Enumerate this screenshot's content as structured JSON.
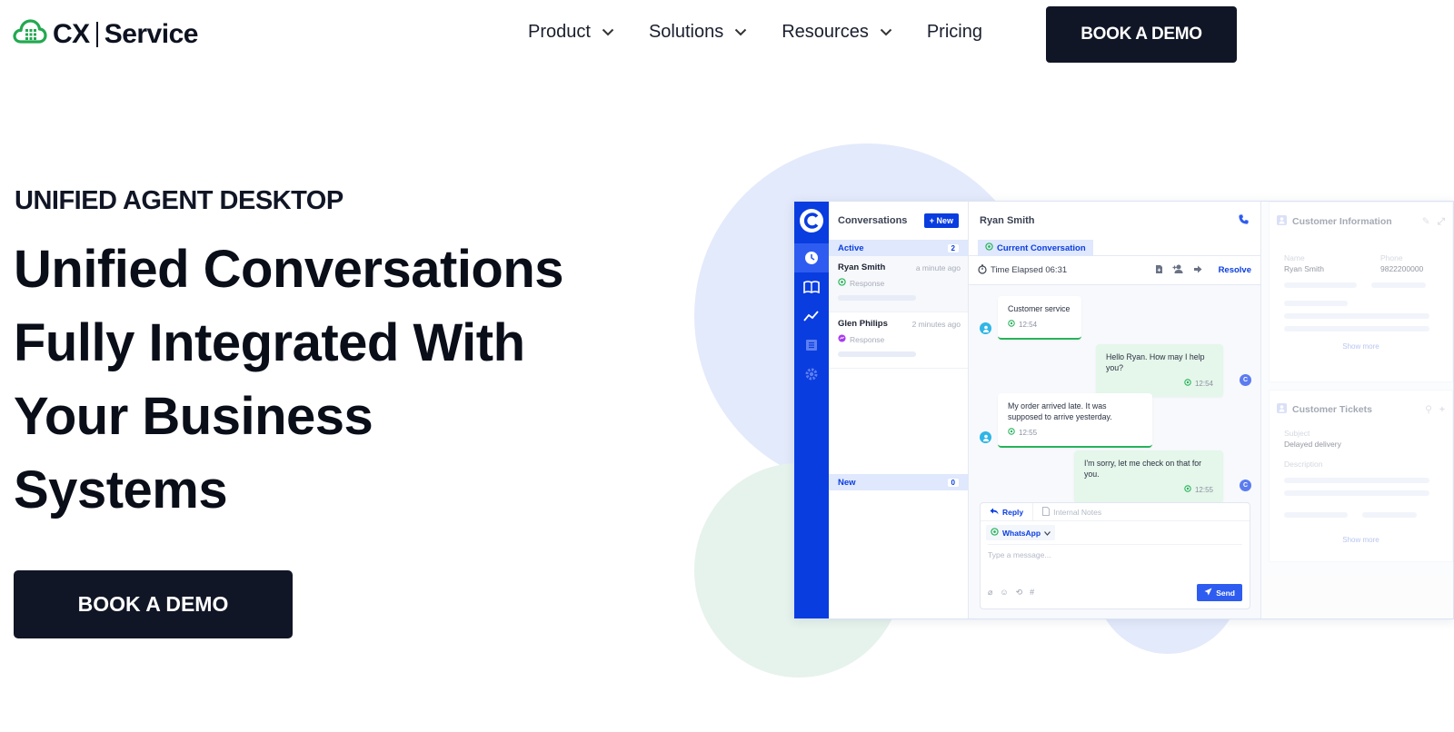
{
  "brand": {
    "name_left": "CX",
    "name_right": "Service"
  },
  "nav": {
    "items": [
      {
        "label": "Product",
        "dropdown": true
      },
      {
        "label": "Solutions",
        "dropdown": true
      },
      {
        "label": "Resources",
        "dropdown": true
      },
      {
        "label": "Pricing",
        "dropdown": false
      }
    ],
    "cta": "BOOK A DEMO"
  },
  "hero": {
    "eyebrow": "UNIFIED AGENT DESKTOP",
    "headline_lines": [
      "Unified Conversations",
      "Fully Integrated With",
      "Your Business",
      "Systems"
    ],
    "cta": "BOOK A DEMO"
  },
  "app": {
    "conversations_title": "Conversations",
    "new_button": "+ New",
    "active": {
      "label": "Active",
      "count": "2"
    },
    "items": [
      {
        "name": "Ryan Smith",
        "time": "a minute ago",
        "sub": "Response",
        "channel": "whatsapp"
      },
      {
        "name": "Glen Philips",
        "time": "2 minutes ago",
        "sub": "Response",
        "channel": "messenger"
      }
    ],
    "new_section": {
      "label": "New",
      "count": "0"
    },
    "chat": {
      "contact": "Ryan Smith",
      "tab": "Current Conversation",
      "elapsed": "Time Elapsed 06:31",
      "resolve": "Resolve",
      "messages": [
        {
          "dir": "in",
          "text": "Customer service",
          "time": "12:54"
        },
        {
          "dir": "out",
          "text": "Hello Ryan. How may I help you?",
          "time": "12:54"
        },
        {
          "dir": "in",
          "text": "My order arrived late. It was supposed to arrive yesterday.",
          "time": "12:55"
        },
        {
          "dir": "out",
          "text": "I'm sorry, let me check on that for you.",
          "time": "12:55"
        }
      ],
      "agent_initial": "C",
      "reply_tab": "Reply",
      "notes_tab": "Internal Notes",
      "channel_select": "WhatsApp",
      "placeholder": "Type a message...",
      "send": "Send"
    },
    "customer_info": {
      "title": "Customer Information",
      "name_label": "Name",
      "name_value": "Ryan Smith",
      "phone_label": "Phone",
      "phone_value": "9822200000",
      "show_more": "Show more"
    },
    "customer_tickets": {
      "title": "Customer Tickets",
      "subject_label": "Subject",
      "subject_value": "Delayed delivery",
      "description_label": "Description",
      "show_more": "Show more"
    }
  },
  "colors": {
    "navy": "#111626",
    "brand_blue": "#0a3de0",
    "whatsapp_green": "#26b35a",
    "logo_green": "#22a94f"
  }
}
